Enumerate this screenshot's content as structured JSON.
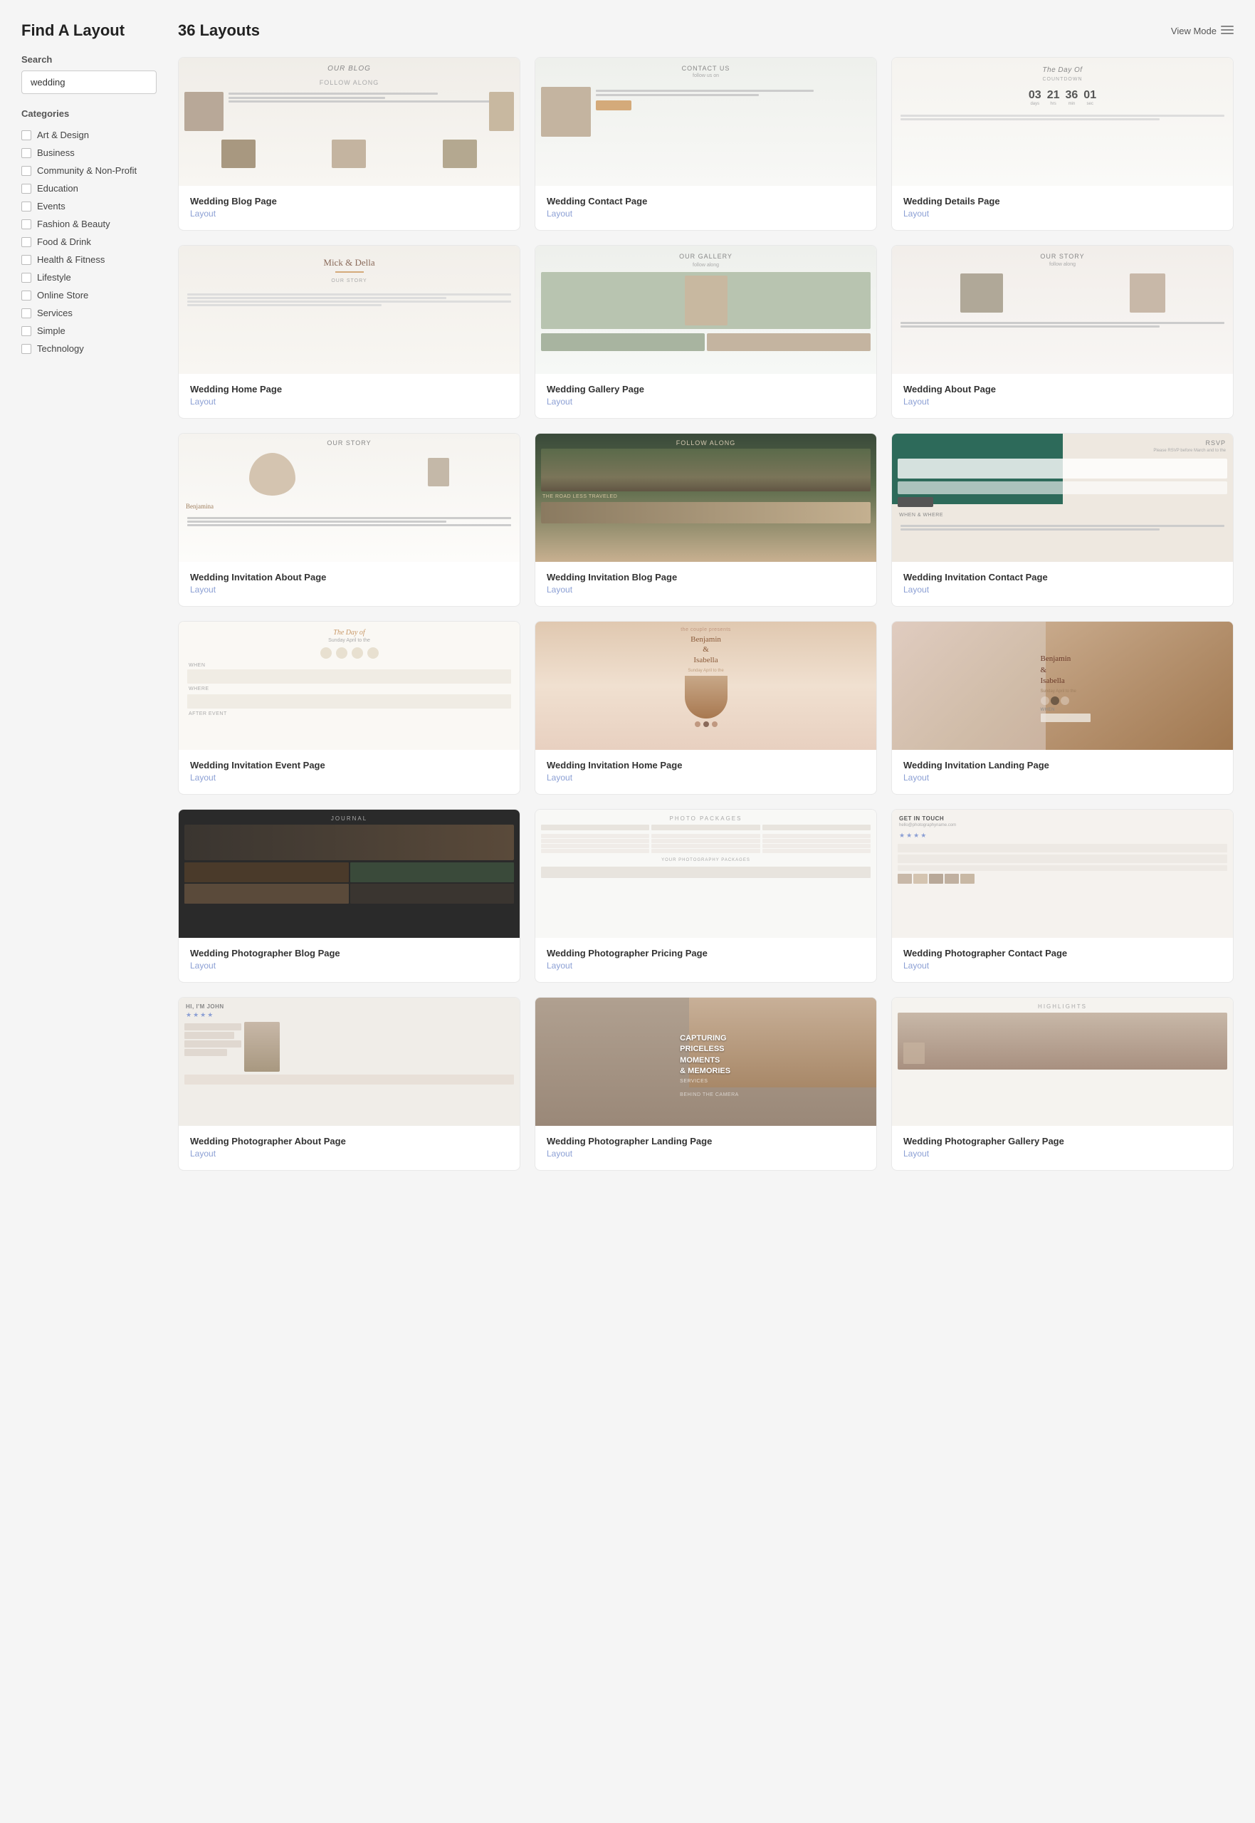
{
  "sidebar": {
    "title": "Find A Layout",
    "search": {
      "label": "Search",
      "value": "wedding",
      "placeholder": "wedding"
    },
    "categories": {
      "label": "Categories",
      "items": [
        {
          "id": "art-design",
          "label": "Art & Design"
        },
        {
          "id": "business",
          "label": "Business"
        },
        {
          "id": "community-non-profit",
          "label": "Community & Non-Profit"
        },
        {
          "id": "education",
          "label": "Education"
        },
        {
          "id": "events",
          "label": "Events"
        },
        {
          "id": "fashion-beauty",
          "label": "Fashion & Beauty"
        },
        {
          "id": "food-drink",
          "label": "Food & Drink"
        },
        {
          "id": "health-fitness",
          "label": "Health & Fitness"
        },
        {
          "id": "lifestyle",
          "label": "Lifestyle"
        },
        {
          "id": "online-store",
          "label": "Online Store"
        },
        {
          "id": "services",
          "label": "Services"
        },
        {
          "id": "simple",
          "label": "Simple"
        },
        {
          "id": "technology",
          "label": "Technology"
        }
      ]
    }
  },
  "main": {
    "count_label": "36 Layouts",
    "view_mode_label": "View Mode",
    "layouts": [
      {
        "id": "wedding-blog",
        "name": "Wedding Blog Page",
        "type": "Layout",
        "preview": "blog"
      },
      {
        "id": "wedding-contact",
        "name": "Wedding Contact Page",
        "type": "Layout",
        "preview": "contact"
      },
      {
        "id": "wedding-details",
        "name": "Wedding Details Page",
        "type": "Layout",
        "preview": "details"
      },
      {
        "id": "wedding-home",
        "name": "Wedding Home Page",
        "type": "Layout",
        "preview": "home"
      },
      {
        "id": "wedding-gallery",
        "name": "Wedding Gallery Page",
        "type": "Layout",
        "preview": "gallery"
      },
      {
        "id": "wedding-about",
        "name": "Wedding About Page",
        "type": "Layout",
        "preview": "about"
      },
      {
        "id": "inv-about",
        "name": "Wedding Invitation About Page",
        "type": "Layout",
        "preview": "inv-about"
      },
      {
        "id": "inv-blog",
        "name": "Wedding Invitation Blog Page",
        "type": "Layout",
        "preview": "inv-blog"
      },
      {
        "id": "inv-contact",
        "name": "Wedding Invitation Contact Page",
        "type": "Layout",
        "preview": "inv-contact"
      },
      {
        "id": "inv-event",
        "name": "Wedding Invitation Event Page",
        "type": "Layout",
        "preview": "inv-event"
      },
      {
        "id": "inv-home",
        "name": "Wedding Invitation Home Page",
        "type": "Layout",
        "preview": "inv-home"
      },
      {
        "id": "inv-landing",
        "name": "Wedding Invitation Landing Page",
        "type": "Layout",
        "preview": "inv-landing"
      },
      {
        "id": "photo-blog",
        "name": "Wedding Photographer Blog Page",
        "type": "Layout",
        "preview": "photo-blog"
      },
      {
        "id": "photo-pricing",
        "name": "Wedding Photographer Pricing Page",
        "type": "Layout",
        "preview": "photo-pricing"
      },
      {
        "id": "photo-contact",
        "name": "Wedding Photographer Contact Page",
        "type": "Layout",
        "preview": "photo-contact"
      },
      {
        "id": "photo-about",
        "name": "Wedding Photographer About Page",
        "type": "Layout",
        "preview": "photo-about"
      },
      {
        "id": "photo-landing",
        "name": "Wedding Photographer Landing Page",
        "type": "Layout",
        "preview": "photo-landing"
      },
      {
        "id": "photo-gallery",
        "name": "Wedding Photographer Gallery Page",
        "type": "Layout",
        "preview": "photo-gallery"
      }
    ]
  },
  "icons": {
    "grid_icon": "▦",
    "checkbox_empty": ""
  }
}
